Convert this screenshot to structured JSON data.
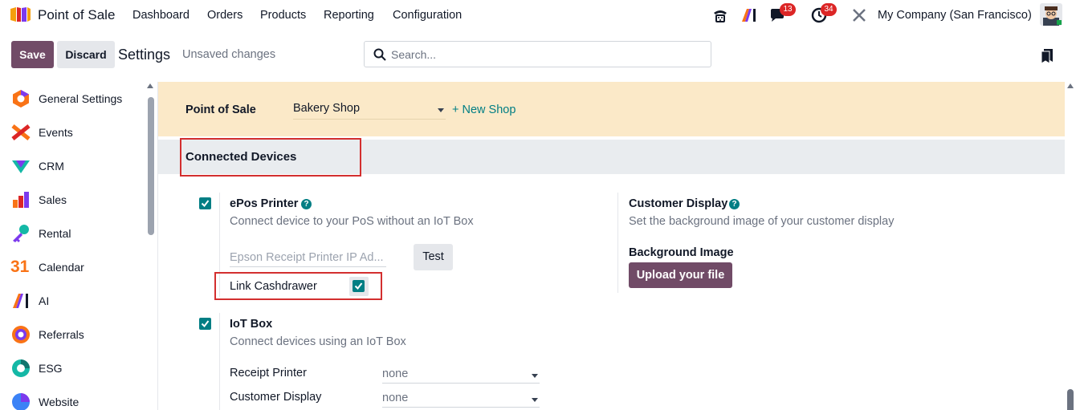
{
  "topnav": {
    "app_name": "Point of Sale",
    "menu": [
      "Dashboard",
      "Orders",
      "Products",
      "Reporting",
      "Configuration"
    ],
    "messages_count": "13",
    "activities_count": "34",
    "company": "My Company (San Francisco)",
    "icons": [
      "phone-icon",
      "ai-icon",
      "chat-icon",
      "clock-icon",
      "tools-icon",
      "avatar"
    ]
  },
  "controlbar": {
    "save_label": "Save",
    "discard_label": "Discard",
    "title": "Settings",
    "status": "Unsaved changes",
    "search_placeholder": "Search..."
  },
  "sidebar": {
    "items": [
      {
        "label": "General Settings",
        "icon": "general-settings-icon"
      },
      {
        "label": "Events",
        "icon": "events-icon"
      },
      {
        "label": "CRM",
        "icon": "crm-icon"
      },
      {
        "label": "Sales",
        "icon": "sales-icon"
      },
      {
        "label": "Rental",
        "icon": "rental-icon"
      },
      {
        "label": "Calendar",
        "icon": "calendar-icon",
        "glyph": "31"
      },
      {
        "label": "AI",
        "icon": "ai-icon"
      },
      {
        "label": "Referrals",
        "icon": "referrals-icon"
      },
      {
        "label": "ESG",
        "icon": "esg-icon"
      },
      {
        "label": "Website",
        "icon": "website-icon"
      }
    ]
  },
  "pos": {
    "label": "Point of Sale",
    "shop": "Bakery Shop",
    "new_shop": "+ New Shop"
  },
  "section": {
    "title": "Connected Devices"
  },
  "epos": {
    "title": "ePos Printer",
    "description": "Connect device to your PoS without an IoT Box",
    "ip_placeholder": "Epson Receipt Printer IP Ad...",
    "test_label": "Test",
    "link_cashdrawer_label": "Link Cashdrawer",
    "checked": true,
    "cashdrawer_checked": true
  },
  "customer_display": {
    "title": "Customer Display",
    "description": "Set the background image of your customer display",
    "bg_title": "Background Image",
    "upload_label": "Upload your file"
  },
  "iot": {
    "title": "IoT Box",
    "description": "Connect devices using an IoT Box",
    "checked": true,
    "fields": [
      {
        "label": "Receipt Printer",
        "value": "none"
      },
      {
        "label": "Customer Display",
        "value": "none"
      }
    ]
  },
  "colors": {
    "brand": "#714B67",
    "accent": "#017e84",
    "highlight": "#d32f2f",
    "pos_band": "#fbe9c8",
    "badge": "#dc2626"
  }
}
